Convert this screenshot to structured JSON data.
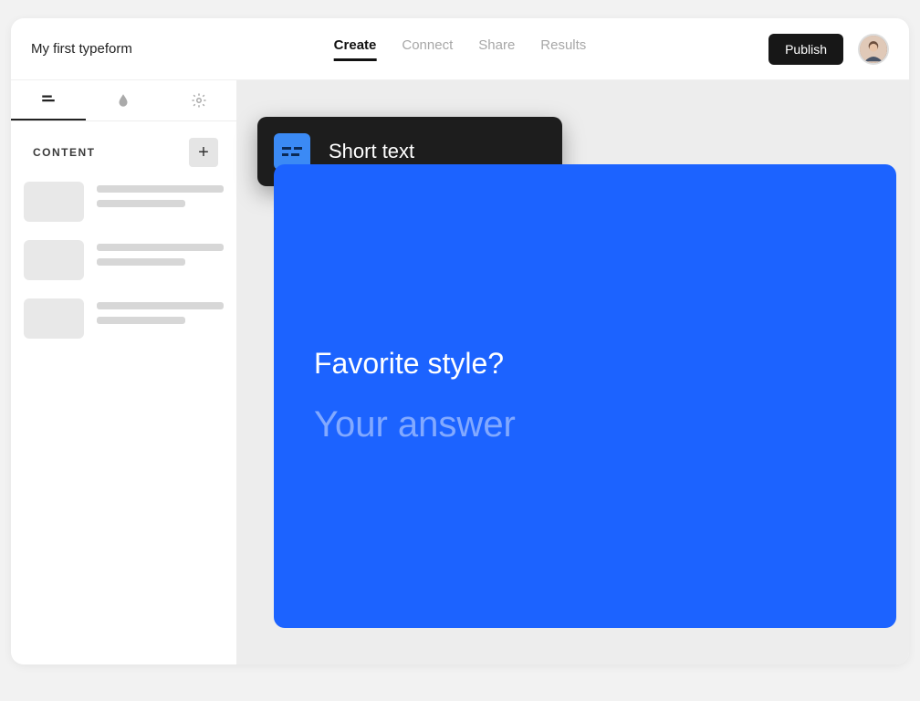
{
  "header": {
    "title": "My first typeform",
    "tabs": {
      "create": "Create",
      "connect": "Connect",
      "share": "Share",
      "results": "Results"
    },
    "publish_label": "Publish"
  },
  "sidebar": {
    "content_label": "CONTENT",
    "add_glyph": "+"
  },
  "popover": {
    "type_label": "Short text",
    "icon_glyph": "=="
  },
  "canvas": {
    "question": "Favorite style?",
    "answer_placeholder": "Your answer"
  },
  "colors": {
    "canvas_bg": "#1C63FF",
    "popover_bg": "#1d1d1d",
    "popover_icon_bg": "#3b8af5"
  }
}
